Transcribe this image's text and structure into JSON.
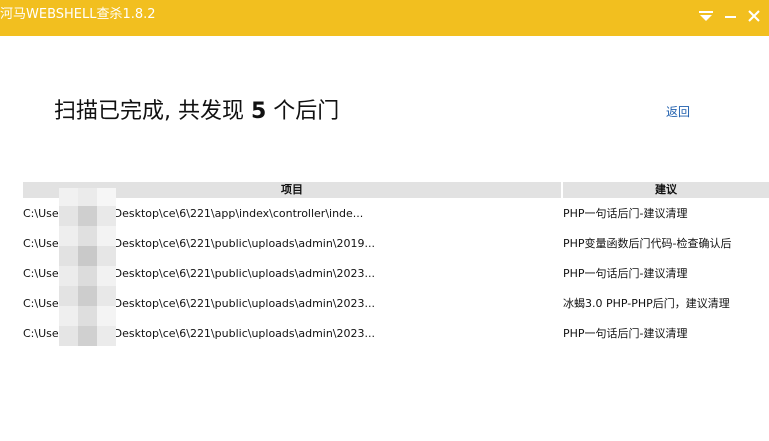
{
  "window": {
    "title": "河马WEBSHELL查杀1.8.2",
    "menu_icon": "triangle-down-icon",
    "minimize_icon": "minimize-icon",
    "close_icon": "close-icon"
  },
  "result": {
    "heading_prefix": "扫描已完成, 共发现 ",
    "count": "5",
    "heading_suffix": " 个后门",
    "back_label": "返回"
  },
  "table": {
    "columns": [
      "项目",
      "建议"
    ],
    "rows": [
      {
        "path": "C:\\Use     Desktop\\ce\\6\\221\\app\\index\\controller\\inde...",
        "advice": "PHP一句话后门-建议清理"
      },
      {
        "path": "C:\\Use     Desktop\\ce\\6\\221\\public\\uploads\\admin\\2019...",
        "advice": "PHP变量函数后门代码-检查确认后"
      },
      {
        "path": "C:\\Use     Desktop\\ce\\6\\221\\public\\uploads\\admin\\2023...",
        "advice": "PHP一句话后门-建议清理"
      },
      {
        "path": "C:\\Use     Desktop\\ce\\6\\221\\public\\uploads\\admin\\2023...",
        "advice": "冰蝎3.0 PHP-PHP后门，建议清理"
      },
      {
        "path": "C:\\Use     Desktop\\ce\\6\\221\\public\\uploads\\admin\\2023...",
        "advice": "PHP一句话后门-建议清理"
      }
    ]
  },
  "colors": {
    "titlebar": "#f2bf1f",
    "link": "#1f5fae",
    "header_bg": "#e2e2e2"
  }
}
